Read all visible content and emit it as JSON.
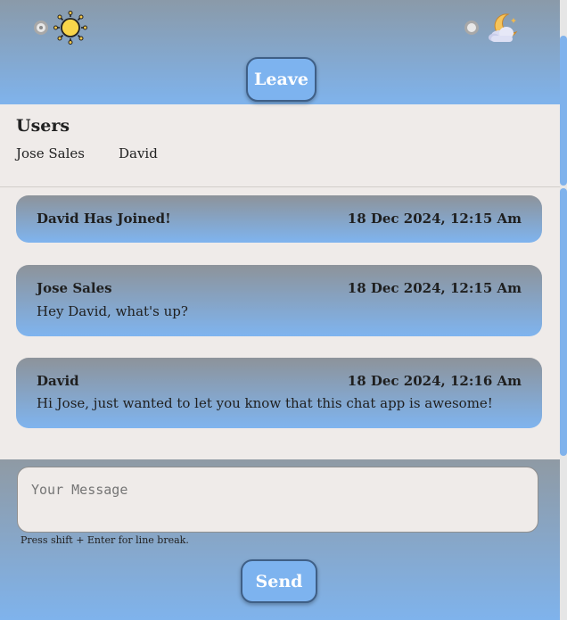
{
  "theme": {
    "light_icon": "sun-icon",
    "dark_icon": "moon-cloud-icon"
  },
  "header": {
    "leave_label": "Leave"
  },
  "users": {
    "title": "Users",
    "list": [
      "Jose Sales",
      "David"
    ]
  },
  "messages": [
    {
      "author": "David Has Joined!",
      "time": "18 Dec 2024, 12:15 Am",
      "text": ""
    },
    {
      "author": "Jose Sales",
      "time": "18 Dec 2024, 12:15 Am",
      "text": "Hey David, what's up?"
    },
    {
      "author": "David",
      "time": "18 Dec 2024, 12:16 Am",
      "text": "Hi Jose, just wanted to let you know that this chat app is awesome!"
    }
  ],
  "composer": {
    "placeholder": "Your Message",
    "hint": "Press shift + Enter for line break.",
    "send_label": "Send"
  },
  "colors": {
    "accent": "#7db3ef",
    "background": "#efebe9"
  }
}
